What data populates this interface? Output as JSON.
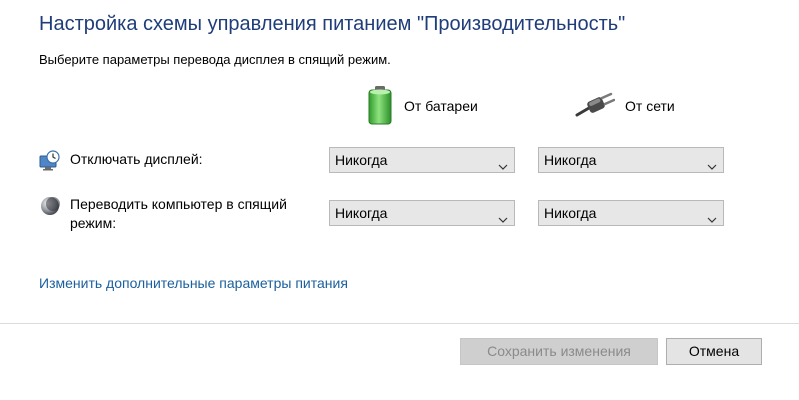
{
  "header": {
    "title": "Настройка схемы управления питанием \"Производительность\"",
    "subtitle": "Выберите параметры перевода дисплея в спящий режим."
  },
  "columns": {
    "battery": {
      "label": "От батареи",
      "icon": "battery-icon"
    },
    "ac": {
      "label": "От сети",
      "icon": "power-plug-icon"
    }
  },
  "rows": [
    {
      "label": "Отключать дисплей:",
      "icon": "display-clock-icon",
      "battery_value": "Никогда",
      "ac_value": "Никогда"
    },
    {
      "label": "Переводить компьютер в спящий режим:",
      "icon": "sleep-moon-icon",
      "battery_value": "Никогда",
      "ac_value": "Никогда"
    }
  ],
  "link": {
    "label": "Изменить дополнительные параметры питания"
  },
  "footer": {
    "save_label": "Сохранить изменения",
    "save_enabled": false,
    "cancel_label": "Отмена"
  },
  "colors": {
    "title": "#1f3d7a",
    "link": "#1a5f9e",
    "battery_green": "#3dbb3a"
  }
}
